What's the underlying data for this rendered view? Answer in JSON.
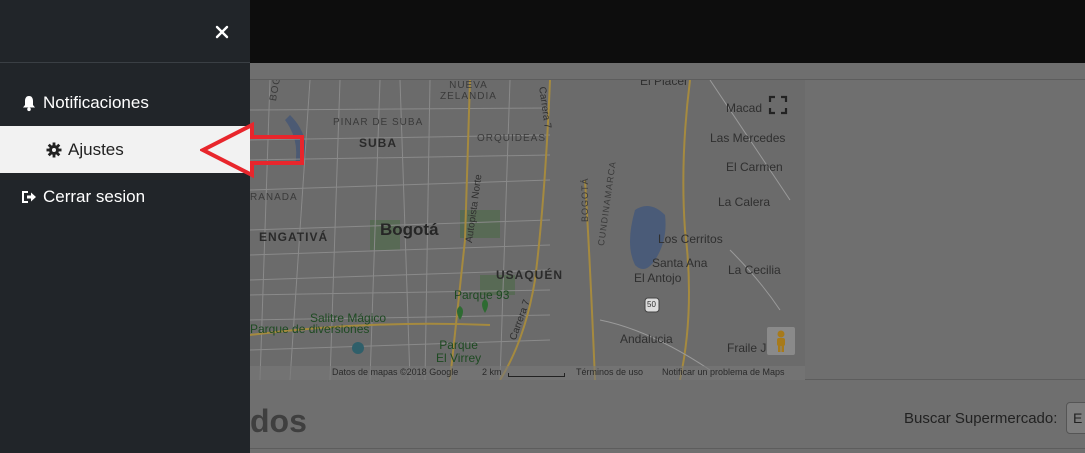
{
  "sidebar": {
    "items": [
      {
        "label": "Notificaciones",
        "icon": "bell-icon"
      },
      {
        "label": "Ajustes",
        "icon": "gear-icon",
        "active": true
      },
      {
        "label": "Cerrar sesion",
        "icon": "sign-out-icon"
      }
    ],
    "close_icon": "close-icon"
  },
  "map": {
    "labels": {
      "nueva_zelandia": "NUEVA\nZELANDIA",
      "el_placer": "El Placer",
      "macad": "Macad",
      "las_mercedes": "Las Mercedes",
      "el_carmen": "El Carmen",
      "la_calera": "La Calera",
      "los_cerritos": "Los Cerritos",
      "santa_ana": "Santa Ana",
      "el_antojo": "El Antojo",
      "la_cecilia": "La Cecilia",
      "andalucia": "Andalucia",
      "fraile": "Fraile J",
      "pinar_de_suba": "PINAR DE SUBA",
      "suba": "SUBA",
      "orquideas": "ORQUIDEAS",
      "engativa": "ENGATIVÁ",
      "bogota": "Bogotá",
      "usaquen": "USAQUÉN",
      "parque_93": "Parque 93",
      "salitre": "Salitre Mágico",
      "parque_diversiones": "Parque de diversiones",
      "parque_virrey": "Parque\nEl Virrey",
      "ranada": "RANADA",
      "bogota_road": "BOGOTÁ",
      "autopista_norte": "Autopista Norte",
      "carrera_7": "Carrera 7",
      "carrera_7b": "Carrera 7",
      "bogota_vert": "BOGOTÁ",
      "cundinamarca": "CUNDINAMARCA",
      "route_50": "50"
    },
    "footer": {
      "data": "Datos de mapas ©2018 Google",
      "scale": "2 km",
      "terms": "Términos de uso",
      "report": "Notificar un problema de Maps"
    }
  },
  "page": {
    "heading_fragment": "dos",
    "search_label": "Buscar Supermercado:",
    "search_value": "E"
  },
  "colors": {
    "sidebar_bg": "#212529",
    "active_bg": "#f2f2f2",
    "arrow": "#e8262c"
  }
}
